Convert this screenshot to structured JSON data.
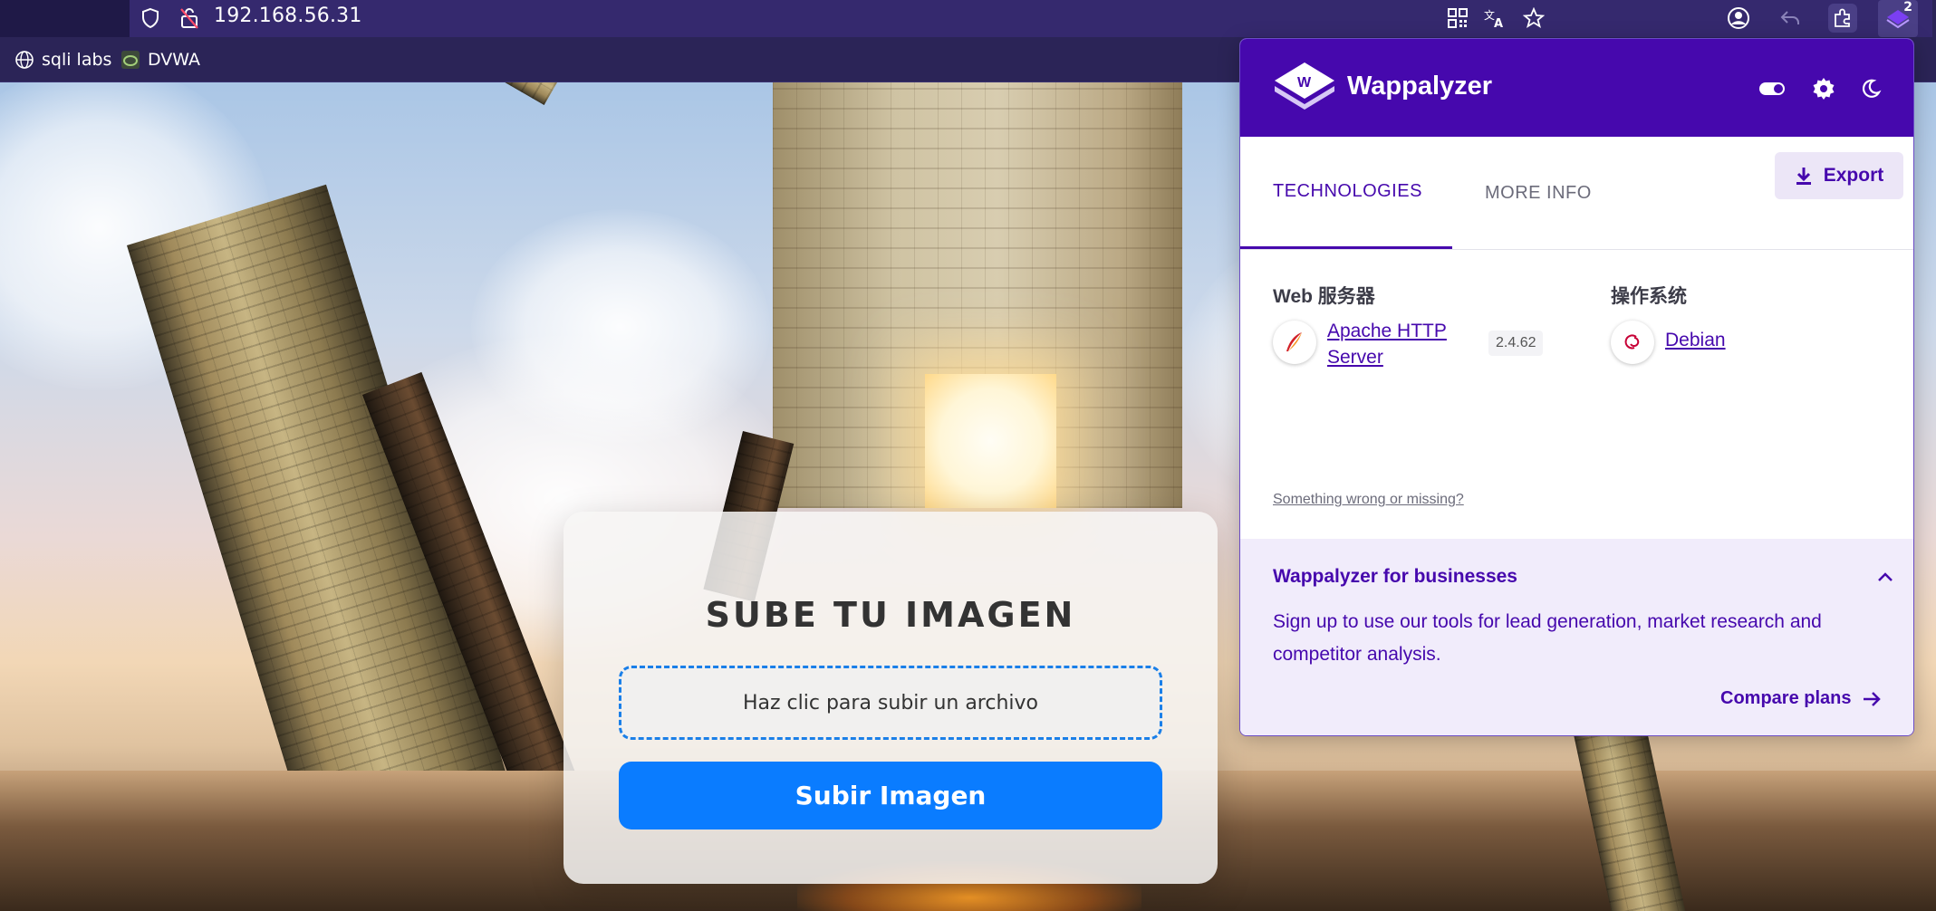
{
  "browser": {
    "url": "192.168.56.31",
    "extension_badge": "2",
    "bookmarks": [
      {
        "label": "sqli labs",
        "icon": "globe-icon"
      },
      {
        "label": "DVWA",
        "icon": "dvwa-icon"
      }
    ]
  },
  "page": {
    "title": "SUBE TU IMAGEN",
    "drop_zone_label": "Haz clic para subir un archivo",
    "submit_label": "Subir Imagen",
    "accent_color": "#0a7cff"
  },
  "wappalyzer": {
    "brand": "Wappalyzer",
    "brand_color": "#4608ad",
    "tabs": [
      "TECHNOLOGIES",
      "MORE INFO"
    ],
    "active_tab": "TECHNOLOGIES",
    "export_label": "Export",
    "categories": [
      {
        "name": "Web 服务器",
        "technologies": [
          {
            "name_line1": "Apache HTTP",
            "name_line2": "Server",
            "version": "2.4.62",
            "icon": "apache-feather-icon"
          }
        ]
      },
      {
        "name": "操作系统",
        "technologies": [
          {
            "name": "Debian",
            "icon": "debian-swirl-icon"
          }
        ]
      }
    ],
    "wrong_link": "Something wrong or missing?",
    "business": {
      "title": "Wappalyzer for businesses",
      "text": "Sign up to use our tools for lead generation, market research and competitor analysis.",
      "cta": "Compare plans"
    }
  }
}
